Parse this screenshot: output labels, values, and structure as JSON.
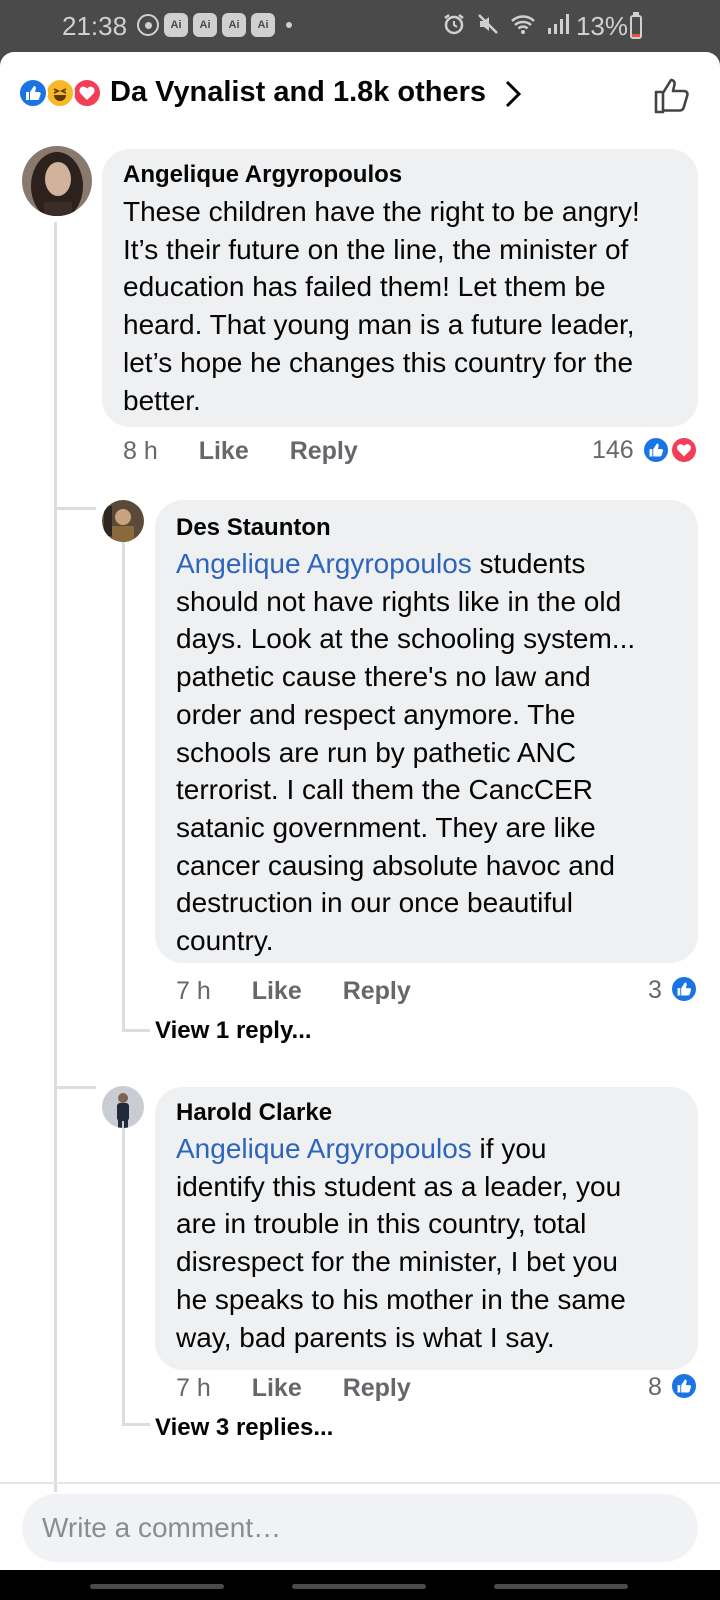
{
  "status_bar": {
    "time": "21:38",
    "ai_badges": [
      "Ai",
      "Ai",
      "Ai",
      "Ai"
    ],
    "battery_text": "13%",
    "battery_level": 0.13,
    "icons": [
      "alarm-icon",
      "mute-icon",
      "wifi-icon",
      "signal-icon",
      "battery-icon"
    ]
  },
  "header": {
    "reaction_icons": [
      "like-reaction-icon",
      "haha-reaction-icon",
      "love-reaction-icon"
    ],
    "reactors_text": "Da Vynalist and 1.8k others",
    "colors": {
      "like": "#1b74e4",
      "haha": "#f7b928",
      "love": "#f33e58"
    }
  },
  "comments": [
    {
      "author": "Angelique Argyropoulos",
      "lines": [
        "These children have the right to be angry!",
        "It’s their future on the line, the minister of",
        "education has failed them! Let them be",
        "heard. That young man is a future leader,",
        "let’s hope he changes this country for the",
        "better."
      ],
      "time": "8 h",
      "like_label": "Like",
      "reply_label": "Reply",
      "reaction_count": "146"
    },
    {
      "author": "Des Staunton",
      "mention": "Angelique Argyropoulos",
      "lines": [
        " students",
        "should not have rights like in the old",
        "days. Look at the schooling system...",
        "pathetic cause there's no law and",
        "order and respect anymore. The",
        "schools are run by pathetic ANC",
        "terrorist. I call them the CancCER",
        "satanic government. They are like",
        "cancer causing absolute havoc and",
        "destruction in our once beautiful",
        "country."
      ],
      "time": "7 h",
      "like_label": "Like",
      "reply_label": "Reply",
      "reaction_count": "3",
      "view_replies": "View 1 reply..."
    },
    {
      "author": "Harold Clarke",
      "mention": "Angelique Argyropoulos",
      "lines": [
        " if you",
        "identify this student as a leader, you",
        "are in trouble in this country, total",
        "disrespect for the minister, I bet you",
        "he speaks to his mother in the same",
        "way, bad parents is what I say."
      ],
      "time": "7 h",
      "like_label": "Like",
      "reply_label": "Reply",
      "reaction_count": "8",
      "view_replies": "View 3 replies..."
    }
  ],
  "composer": {
    "placeholder": "Write a comment…"
  }
}
